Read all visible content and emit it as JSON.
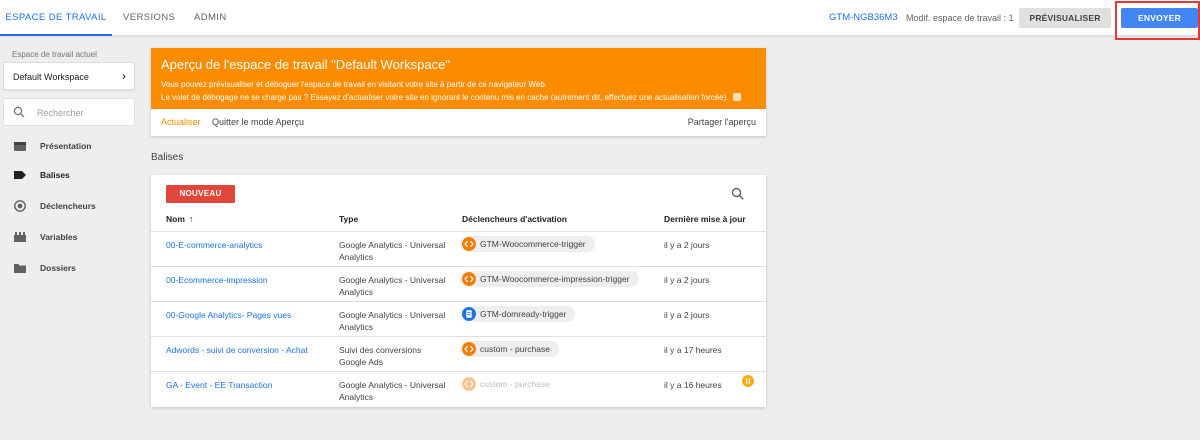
{
  "topbar": {
    "tabs": [
      {
        "label": "ESPACE DE TRAVAIL",
        "active": true
      },
      {
        "label": "VERSIONS",
        "active": false
      },
      {
        "label": "ADMIN",
        "active": false
      }
    ],
    "container_id": "GTM-NGB36M3",
    "workspace_changes": "Modif. espace de travail : 1",
    "preview_label": "PRÉVISUALISER",
    "submit_label": "ENVOYER",
    "submit_color": "#4285f4",
    "highlight_color": "#e53935"
  },
  "sidebar": {
    "workspace_label": "Espace de travail actuel",
    "workspace_name": "Default Workspace",
    "search_placeholder": "Rechercher",
    "items": [
      {
        "label": "Présentation",
        "icon": "overview-icon",
        "active": false
      },
      {
        "label": "Balises",
        "icon": "tag-icon",
        "active": true
      },
      {
        "label": "Déclencheurs",
        "icon": "trigger-icon",
        "active": false
      },
      {
        "label": "Variables",
        "icon": "variables-icon",
        "active": false
      },
      {
        "label": "Dossiers",
        "icon": "folder-icon",
        "active": false
      }
    ]
  },
  "preview": {
    "title": "Aperçu de l'espace de travail \"Default Workspace\"",
    "line1": "Vous pouvez prévisualiser et déboguer l'espace de travail en visitant votre site à partir de ce navigateur Web.",
    "line2": "Le volet de débogage ne se charge pas ? Essayez d'actualiser votre site en ignorant le contenu mis en cache (autrement dit, effectuez une actualisation forcée).",
    "action_refresh": "Actualiser",
    "action_quit": "Quitter le mode Aperçu",
    "action_share": "Partager l'aperçu",
    "banner_color": "#fb8c00"
  },
  "tags": {
    "section_title": "Balises",
    "new_label": "NOUVEAU",
    "columns": {
      "name": "Nom",
      "type": "Type",
      "triggers": "Déclencheurs d'activation",
      "updated": "Dernière mise à jour"
    },
    "sort_arrow": "↑",
    "rows": [
      {
        "name": "00-E-commerce-analytics",
        "type": "Google Analytics - Universal Analytics",
        "trigger": "GTM-Woocommerce-trigger",
        "trigger_icon": "custom-event-icon",
        "updated": "il y a 2 jours"
      },
      {
        "name": "00-Ecommerce-impression",
        "type": "Google Analytics - Universal Analytics",
        "trigger": "GTM-Woocommerce-impression-trigger",
        "trigger_icon": "custom-event-icon",
        "updated": "il y a 2 jours"
      },
      {
        "name": "00-Google Analytics- Pages vues",
        "type": "Google Analytics - Universal Analytics",
        "trigger": "GTM-domready-trigger",
        "trigger_icon": "page-view-icon",
        "updated": "il y a 2 jours"
      },
      {
        "name": "Adwords - suivi de conversion - Achat",
        "type": "Suivi des conversions Google Ads",
        "trigger": "custom - purchase",
        "trigger_icon": "custom-event-icon",
        "updated": "il y a 17 heures"
      },
      {
        "name": "GA - Event - EE Transaction",
        "type": "Google Analytics - Universal Analytics",
        "trigger": "custom - purchase",
        "trigger_icon": "custom-event-icon",
        "updated": "il y a 16 heures",
        "paused": true
      }
    ]
  }
}
